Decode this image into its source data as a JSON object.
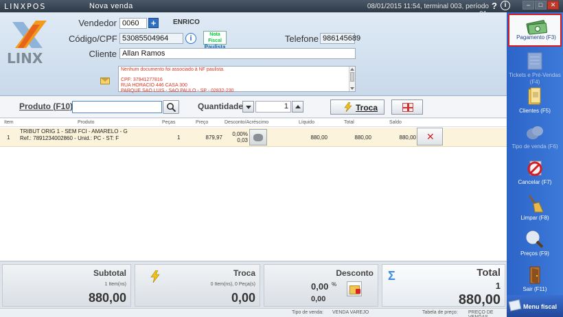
{
  "topbar": {
    "brand": "LINXPOS",
    "title": "Nova venda",
    "status": "08/01/2015 11:54, terminal 003, período 01.",
    "help": "?",
    "info": "i",
    "min": "–",
    "max": "□",
    "close": "✕"
  },
  "header": {
    "logo_text": "LINX",
    "vendedor_label": "Vendedor",
    "vendedor_code": "0060",
    "vendedor_name": "ENRICO",
    "plus": "+",
    "cpf_label": "Código/CPF",
    "cpf_value": "53085504964",
    "nota_line1": "Nota Fiscal",
    "nota_line2": "Paulista",
    "telefone_label": "Telefone",
    "telefone_value": "986145689",
    "cliente_label": "Cliente",
    "cliente_value": "Allan Ramos",
    "notes": {
      "line1": "Nenhum documento foi associado à NF paulista.",
      "line2": "CPF: 37941277816",
      "line3": "RUA HORACIO 446 CASA 300",
      "line4": "PARQUE SAO LUIS - SAO PAULO - SP - 02832-230"
    }
  },
  "product_bar": {
    "produto_label": "Produto (F10)",
    "produto_value": "",
    "quantidade_label": "Quantidade",
    "quantidade_value": "1",
    "troca_label": "Troca"
  },
  "grid": {
    "columns": {
      "item": "Item",
      "produto": "Produto",
      "pecas": "Peças",
      "preco": "Preço",
      "desconto": "Desconto/Acréscimo",
      "liquido": "Líquido",
      "total": "Total",
      "saldo": "Saldo"
    },
    "rows": [
      {
        "item": "1",
        "desc1": "TRIBUT ORIG 1 - SEM FCI - AMARELO - G",
        "desc2": "Ref.: 7891234002860 - Unid.: PC - ST: F",
        "pecas": "1",
        "preco": "879,97",
        "desconto_pct": "0,00%",
        "desconto_val": "0,03",
        "liquido": "880,00",
        "total": "880,00",
        "saldo": "880,00"
      }
    ]
  },
  "totals": {
    "subtotal": {
      "title": "Subtotal",
      "sub": "1 Item(ns)",
      "value": "880,00"
    },
    "troca": {
      "title": "Troca",
      "sub": "0 Item(ns), 0 Peça(s)",
      "value": "0,00"
    },
    "desconto": {
      "title": "Desconto",
      "value1": "0,00",
      "pct": "%",
      "value2": "0,00"
    },
    "total": {
      "title": "Total",
      "count": "1",
      "value": "880,00"
    }
  },
  "statusbar": {
    "tipo_venda_label": "Tipo de venda:",
    "tipo_venda_value": "VENDA VAREJO",
    "tabela_label": "Tabela de preço:",
    "tabela_value": "PREÇO DE VENDAS"
  },
  "sidebar": {
    "items": [
      {
        "label": "Pagamento (F3)",
        "state": "active"
      },
      {
        "label": "Tickets e Pré-Vendas (F4)",
        "state": "disabled"
      },
      {
        "label": "Clientes (F5)",
        "state": "normal"
      },
      {
        "label": "Tipo de venda (F6)",
        "state": "disabled"
      },
      {
        "label": "Cancelar (F7)",
        "state": "normal"
      },
      {
        "label": "Limpar (F8)",
        "state": "normal"
      },
      {
        "label": "Preços (F9)",
        "state": "normal"
      },
      {
        "label": "Sair (F11)",
        "state": "normal"
      }
    ],
    "menu_fiscal": "Menu fiscal"
  },
  "colors": {
    "sidebar_blue": "#2c64c8",
    "active_border": "#d61b22",
    "row_highlight": "#fbf3dc",
    "note_red": "#dd3322"
  }
}
